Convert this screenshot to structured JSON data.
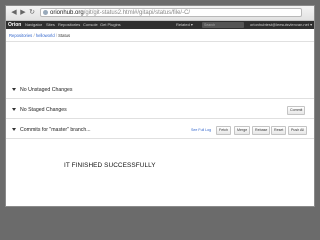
{
  "browser": {
    "address_host": "orionhub.org",
    "address_path": "/git/git-status2.html#/gitapi/status/file/-C/"
  },
  "topnav": {
    "brand": "Orion",
    "links": [
      "Navigator",
      "Sites",
      "Repositories",
      "Console",
      "Get Plugins"
    ],
    "related": "Related ▾",
    "search_placeholder": "Search",
    "user": "orionhubtest@leesuisvlenvan.net ▾"
  },
  "breadcrumb": {
    "items": [
      "Repositories",
      "helloworld"
    ],
    "current": "Status"
  },
  "sections": {
    "unstaged": "No Unstaged Changes",
    "staged": "No Staged Changes",
    "commits": "Commits for \"master\" branch..."
  },
  "buttons": {
    "commit": "Commit",
    "see_full_log": "See Full Log",
    "fetch": "Fetch",
    "merge": "Merge",
    "rebase": "Rebase",
    "reset": "Reset",
    "push_all": "Push All"
  },
  "message": "IT FINISHED SUCCESSFULLY"
}
